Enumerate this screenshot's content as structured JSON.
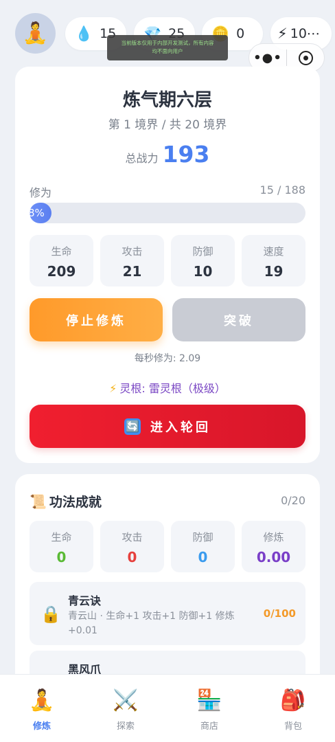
{
  "top": {
    "avatar_icon": "meditating-person",
    "water": {
      "icon": "💧",
      "value": "15"
    },
    "gem": {
      "icon": "💎",
      "value": "25"
    },
    "coin": {
      "icon": "🪙",
      "value": "0"
    },
    "energy": {
      "icon": "⚡",
      "value": "10⋯"
    },
    "tip": "当前版本仅用于内部开发测试，所有内容均不面向用户",
    "capsule": {
      "more_icon": "•●•",
      "close_icon": "record-circle"
    }
  },
  "realm": {
    "title": "炼气期六层",
    "subtitle": "第 1 境界 / 共 20 境界",
    "power_label": "总战力",
    "power_value": "193"
  },
  "cultivation": {
    "label": "修为",
    "value": "15 / 188",
    "percent_text": "8%",
    "percent": 8
  },
  "stats": [
    {
      "label": "生命",
      "value": "209"
    },
    {
      "label": "攻击",
      "value": "21"
    },
    {
      "label": "防御",
      "value": "10"
    },
    {
      "label": "速度",
      "value": "19"
    }
  ],
  "buttons": {
    "stop": "停止修炼",
    "breakthrough": "突破",
    "rebirth": "进入轮回",
    "rebirth_icon": "🔄"
  },
  "rate_text": "每秒修为: 2.09",
  "spirit_root": {
    "icon": "⚡",
    "text": "灵根: 雷灵根（极级）"
  },
  "skills": {
    "icon": "📜",
    "title": "功法成就",
    "count": "0/20",
    "bonuses": [
      {
        "label": "生命",
        "value": "0"
      },
      {
        "label": "攻击",
        "value": "0"
      },
      {
        "label": "防御",
        "value": "0"
      },
      {
        "label": "修炼",
        "value": "0.00"
      }
    ],
    "items": [
      {
        "name": "青云诀",
        "desc": "青云山 · 生命+1 攻击+1 防御+1 修炼+0.01",
        "progress": "0/100"
      },
      {
        "name": "黑风爪"
      }
    ]
  },
  "nav": [
    {
      "icon": "🧘",
      "label": "修炼"
    },
    {
      "icon": "⚔️",
      "label": "探索"
    },
    {
      "icon": "🏪",
      "label": "商店"
    },
    {
      "icon": "🎒",
      "label": "背包"
    }
  ],
  "colors": {
    "accent": "#4a7ff0",
    "stop_button": "#ff9a2a",
    "rebirth_button": "#e81a2c",
    "spirit_text": "#7b48c4"
  }
}
